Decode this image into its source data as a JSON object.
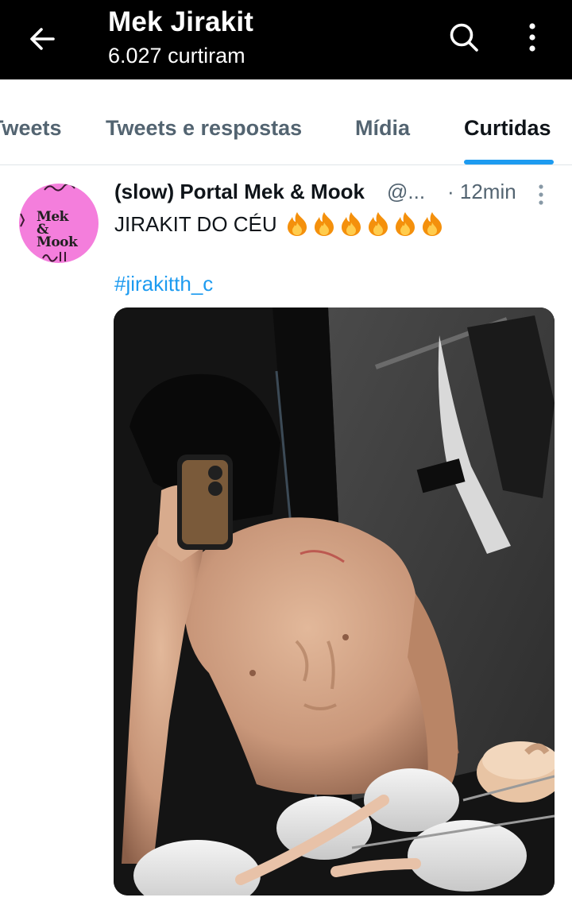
{
  "header": {
    "title": "Mek Jirakit",
    "subtitle": "6.027 curtiram",
    "back_icon": "arrow-left-icon",
    "search_icon": "search-icon",
    "menu_icon": "more-vertical-icon"
  },
  "tabs": [
    {
      "label": "Tweets",
      "active": false
    },
    {
      "label": "Tweets e respostas",
      "active": false
    },
    {
      "label": "Mídia",
      "active": false
    },
    {
      "label": "Curtidas",
      "active": true
    }
  ],
  "tweet": {
    "author_name": "(slow) Portal Mek & Mook",
    "author_handle": "@...",
    "time": "· 12min",
    "text": "JIRAKIT DO CÉU",
    "emoji": "🔥🔥🔥🔥🔥🔥",
    "hashtag": "#jirakitth_c",
    "avatar_text": "Mek & Mook",
    "more_icon": "more-vertical-icon"
  },
  "colors": {
    "header_bg": "#000000",
    "accent": "#1d9bf0",
    "secondary_text": "#536471",
    "primary_text": "#0f1419",
    "avatar_bg": "#f47edc"
  }
}
